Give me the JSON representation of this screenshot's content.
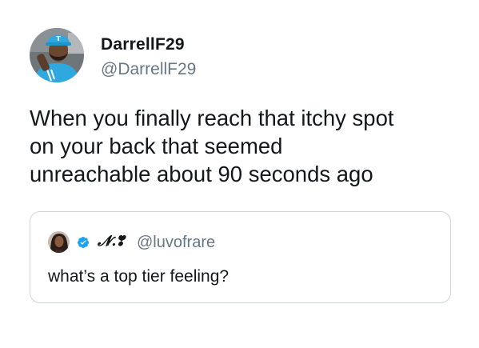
{
  "author": {
    "display_name": "DarrellF29",
    "handle": "@DarrellF29"
  },
  "tweet": {
    "lines": [
      "When you finally reach that itchy spot",
      "on your back that seemed",
      "unreachable about 90 seconds ago"
    ]
  },
  "quoted_tweet": {
    "display_name": "𝓝.❣",
    "handle": "@luvofrare",
    "text": "what’s a top tier feeling?",
    "verified": true
  },
  "colors": {
    "text": "#14171a",
    "secondary": "#657786",
    "verified_badge": "#1da1f2",
    "border": "#d0d6db",
    "avatar_shirt": "#2fa8e0"
  },
  "icons": {
    "author_avatar": "profile-photo",
    "quote_avatar": "profile-photo",
    "verified": "verified-badge-icon"
  }
}
